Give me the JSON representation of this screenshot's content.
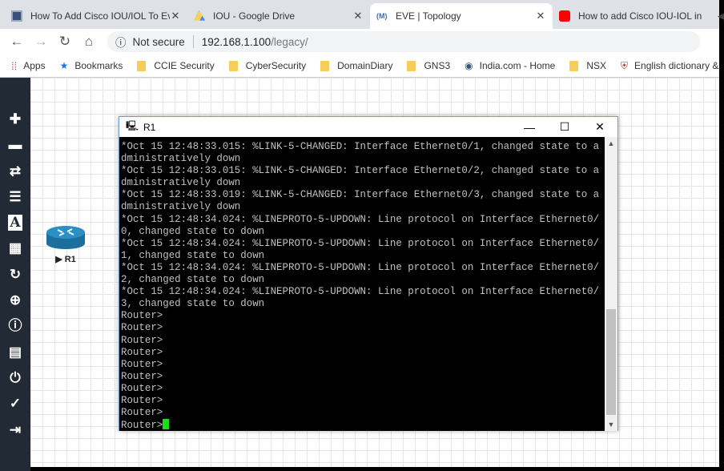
{
  "browser": {
    "tabs": [
      {
        "title": "How To Add Cisco IOU/IOL To Ev",
        "icon": "grid-favicon-icon",
        "active": false
      },
      {
        "title": "IOU - Google Drive",
        "icon": "google-drive-icon",
        "active": false
      },
      {
        "title": "EVE | Topology",
        "icon": "eve-icon",
        "active": true
      },
      {
        "title": "How to add Cisco IOU-IOL in",
        "icon": "youtube-icon",
        "active": false
      }
    ],
    "security_label": "Not secure",
    "url_host": "192.168.1.100",
    "url_path": "/legacy/",
    "bookmarks": [
      "Apps",
      "Bookmarks",
      "CCIE Security",
      "CyberSecurity",
      "DomainDiary",
      "GNS3",
      "India.com - Home",
      "NSX",
      "English dictionary &"
    ]
  },
  "sidebar": {
    "icons": [
      "add-icon",
      "hdd-icon",
      "transfer-icon",
      "align-left-icon",
      "text-icon",
      "grid-icon",
      "refresh-icon",
      "zoom-in-icon",
      "info-icon",
      "list-icon",
      "power-icon",
      "check-circle-icon",
      "logout-icon"
    ]
  },
  "node": {
    "label": "R1"
  },
  "terminal": {
    "title": "R1",
    "lines": [
      "*Oct 15 12:48:33.015: %LINK-5-CHANGED: Interface Ethernet0/1, changed state to a",
      "dministratively down",
      "*Oct 15 12:48:33.015: %LINK-5-CHANGED: Interface Ethernet0/2, changed state to a",
      "dministratively down",
      "*Oct 15 12:48:33.019: %LINK-5-CHANGED: Interface Ethernet0/3, changed state to a",
      "dministratively down",
      "*Oct 15 12:48:34.024: %LINEPROTO-5-UPDOWN: Line protocol on Interface Ethernet0/",
      "0, changed state to down",
      "*Oct 15 12:48:34.024: %LINEPROTO-5-UPDOWN: Line protocol on Interface Ethernet0/",
      "1, changed state to down",
      "*Oct 15 12:48:34.024: %LINEPROTO-5-UPDOWN: Line protocol on Interface Ethernet0/",
      "2, changed state to down",
      "*Oct 15 12:48:34.024: %LINEPROTO-5-UPDOWN: Line protocol on Interface Ethernet0/",
      "3, changed state to down",
      "Router>",
      "Router>",
      "Router>",
      "Router>",
      "Router>",
      "Router>",
      "Router>",
      "Router>",
      "Router>"
    ],
    "prompt": "Router>"
  }
}
